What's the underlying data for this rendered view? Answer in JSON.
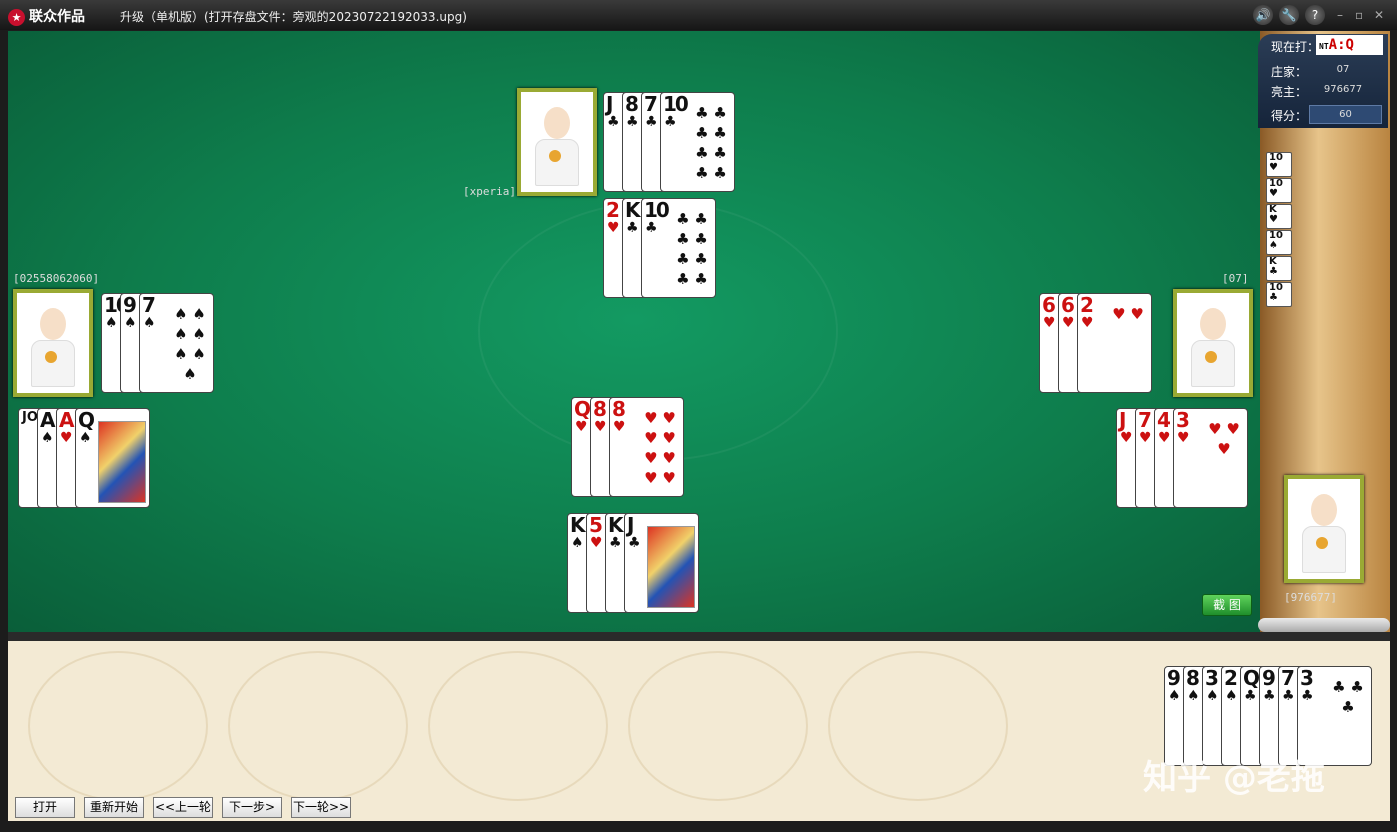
{
  "window": {
    "logo": "联众作品",
    "logo_icon": "★",
    "title": "升级（单机版）(打开存盘文件：旁观的20230722192033.upg)",
    "icons": {
      "sound": "🔊",
      "settings": "🔧",
      "help": "?",
      "minimize": "–",
      "restore": "▫",
      "close": "✕"
    }
  },
  "info": {
    "playing_label": "现在打：",
    "playing_nt": "NT",
    "playing_value": "A:Q",
    "dealer_label": "庄家：",
    "dealer_value": "07",
    "trump_label": "亮主：",
    "trump_value": "976677",
    "score_label": "得分：",
    "score_value": "60"
  },
  "trick_history": [
    {
      "rank": "10",
      "suit": "♥"
    },
    {
      "rank": "10",
      "suit": "♥"
    },
    {
      "rank": "K",
      "suit": "♥"
    },
    {
      "rank": "10",
      "suit": "♠"
    },
    {
      "rank": "K",
      "suit": "♣"
    },
    {
      "rank": "10",
      "suit": "♣"
    }
  ],
  "players": {
    "top": "[xperia]",
    "left": "[02558062060]",
    "right": "[07]",
    "bottom": "[976677]"
  },
  "plays": {
    "top_prev": [
      {
        "r": "J",
        "s": "♣"
      },
      {
        "r": "8",
        "s": "♣"
      },
      {
        "r": "7",
        "s": "♣"
      },
      {
        "r": "10",
        "s": "♣"
      }
    ],
    "top": [
      {
        "r": "2",
        "s": "♥"
      },
      {
        "r": "K",
        "s": "♣"
      },
      {
        "r": "10",
        "s": "♣"
      }
    ],
    "left_prev": [
      {
        "r": "10",
        "s": "♠"
      },
      {
        "r": "9",
        "s": "♠"
      },
      {
        "r": "7",
        "s": "♠"
      }
    ],
    "left": [
      {
        "r": "JOKER",
        "s": ""
      },
      {
        "r": "A",
        "s": "♠"
      },
      {
        "r": "A",
        "s": "♥"
      },
      {
        "r": "Q",
        "s": "♠"
      }
    ],
    "right_prev": [
      {
        "r": "6",
        "s": "♥"
      },
      {
        "r": "6",
        "s": "♥"
      },
      {
        "r": "2",
        "s": "♥"
      }
    ],
    "right": [
      {
        "r": "J",
        "s": "♥"
      },
      {
        "r": "7",
        "s": "♥"
      },
      {
        "r": "4",
        "s": "♥"
      },
      {
        "r": "3",
        "s": "♥"
      }
    ],
    "center_prev": [
      {
        "r": "Q",
        "s": "♥"
      },
      {
        "r": "8",
        "s": "♥"
      },
      {
        "r": "8",
        "s": "♥"
      }
    ],
    "center": [
      {
        "r": "K",
        "s": "♠"
      },
      {
        "r": "5",
        "s": "♥"
      },
      {
        "r": "K",
        "s": "♣"
      },
      {
        "r": "J",
        "s": "♣"
      }
    ]
  },
  "hand": [
    {
      "r": "9",
      "s": "♠"
    },
    {
      "r": "8",
      "s": "♠"
    },
    {
      "r": "3",
      "s": "♠"
    },
    {
      "r": "2",
      "s": "♠"
    },
    {
      "r": "Q",
      "s": "♣"
    },
    {
      "r": "9",
      "s": "♣"
    },
    {
      "r": "7",
      "s": "♣"
    },
    {
      "r": "3",
      "s": "♣"
    }
  ],
  "buttons": {
    "screenshot": "截 图",
    "open": "打开",
    "restart": "重新开始",
    "prev_round": "<<上一轮",
    "next_step": "下一步>",
    "next_round": "下一轮>>"
  },
  "watermark": "知乎 @老拖",
  "colors": {
    "felt": "#0e7d4c",
    "avatar_frame": "#9aaa34",
    "screenshot_btn": "#1f8e2b"
  }
}
